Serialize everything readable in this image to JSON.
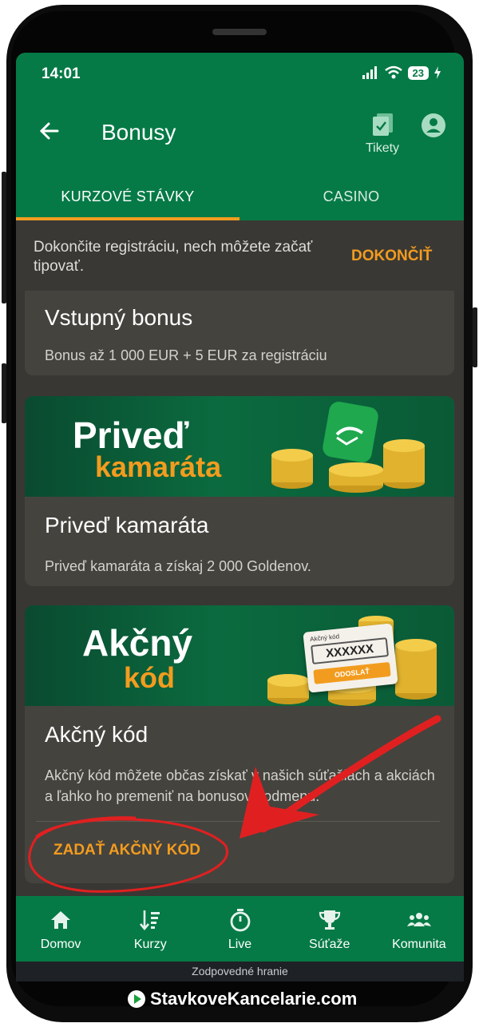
{
  "status": {
    "time": "14:01",
    "battery": "23"
  },
  "header": {
    "title": "Bonusy",
    "tickets_label": "Tikety"
  },
  "tabs": [
    {
      "label": "KURZOVÉ STÁVKY"
    },
    {
      "label": "CASINO"
    }
  ],
  "registration_banner": {
    "text": "Dokončite registráciu, nech môžete začať tipovať.",
    "action": "DOKONČIŤ"
  },
  "cards": [
    {
      "title": "Vstupný bonus",
      "description": "Bonus až 1 000 EUR + 5 EUR za registráciu"
    },
    {
      "image_line1": "Priveď",
      "image_line2": "kamaráta",
      "title": "Priveď kamaráta",
      "description": "Priveď kamaráta a získaj 2 000 Goldenov."
    },
    {
      "image_line1": "Akčný",
      "image_line2": "kód",
      "image_code_label": "Akčný kód",
      "image_code_value": "XXXXXX",
      "image_code_button": "ODOSLAŤ",
      "title": "Akčný kód",
      "description": "Akčný kód môžete občas získať v našich súťažiach a akciách a ľahko ho premeniť na bonusovú odmenu.",
      "action": "ZADAŤ AKČNÝ KÓD"
    }
  ],
  "bottom_nav": [
    {
      "label": "Domov",
      "icon": "home-icon"
    },
    {
      "label": "Kurzy",
      "icon": "sort-list-icon"
    },
    {
      "label": "Live",
      "icon": "stopwatch-icon"
    },
    {
      "label": "Súťaže",
      "icon": "trophy-icon"
    },
    {
      "label": "Komunita",
      "icon": "people-icon"
    }
  ],
  "footer": {
    "responsible": "Zodpovedné hranie",
    "brand": "StavkoveKancelarie.com"
  },
  "colors": {
    "brand_green": "#057a46",
    "accent_orange": "#f29c1f",
    "background": "#393733",
    "card": "#45433e",
    "annotation_red": "#e02020"
  }
}
